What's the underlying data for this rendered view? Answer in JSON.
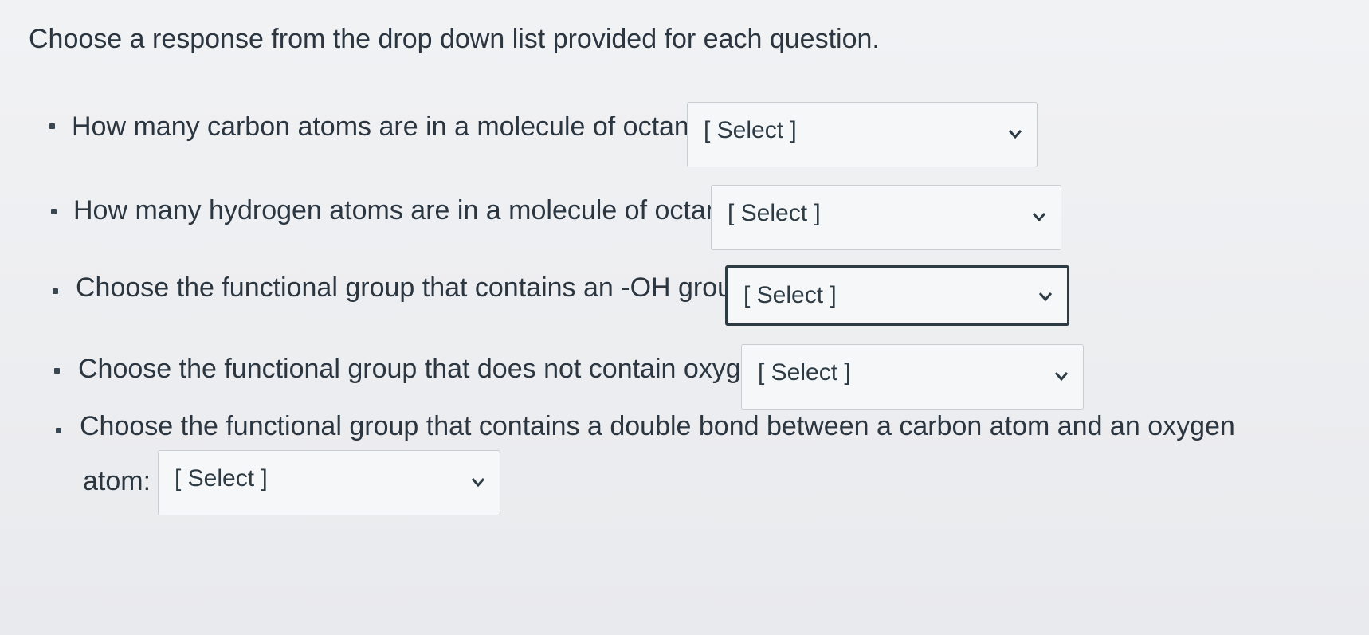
{
  "instructions": "Choose a response from the drop down list provided for each question.",
  "questions": [
    {
      "text": "How many carbon atoms are in a molecule of octane?",
      "select": {
        "value": "[ Select ]"
      }
    },
    {
      "text": "How many hydrogen atoms are in a molecule of octane?",
      "select": {
        "value": "[ Select ]"
      }
    },
    {
      "text": "Choose the functional group that contains an -OH group:",
      "select": {
        "value": "[ Select ]",
        "focused": true
      }
    },
    {
      "text": "Choose the functional group that does not contain oxygen:",
      "select": {
        "value": "[ Select ]"
      }
    },
    {
      "text": "Choose the functional group that contains a double bond between a carbon atom and an oxygen",
      "text_cont": "atom:",
      "select": {
        "value": "[ Select ]"
      }
    }
  ],
  "icons": {
    "dropdown": "chevron-down-icon"
  }
}
